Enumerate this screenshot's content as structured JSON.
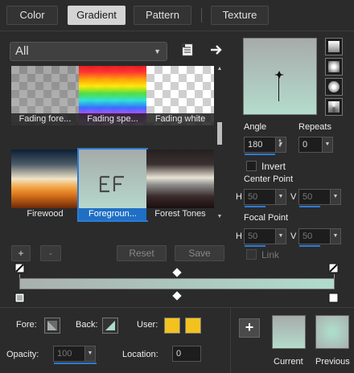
{
  "tabs": [
    {
      "label": "Color",
      "active": false
    },
    {
      "label": "Gradient",
      "active": true
    },
    {
      "label": "Pattern",
      "active": false
    },
    {
      "label": "Texture",
      "active": false
    }
  ],
  "category": {
    "value": "All"
  },
  "gradients": [
    {
      "label": "Fading fore..."
    },
    {
      "label": "Fading spe..."
    },
    {
      "label": "Fading white"
    },
    {
      "label": "Firewood"
    },
    {
      "label": "Foregroun...",
      "selected": true
    },
    {
      "label": "Forest Tones"
    }
  ],
  "editor_buttons": {
    "add": "+",
    "remove": "-",
    "reset": "Reset",
    "save": "Save"
  },
  "angle": {
    "label": "Angle",
    "value": "180"
  },
  "repeats": {
    "label": "Repeats",
    "value": "0"
  },
  "invert": {
    "label": "Invert",
    "checked": false
  },
  "center_point": {
    "label": "Center Point",
    "h_label": "H",
    "h": "50",
    "v_label": "V",
    "v": "50"
  },
  "focal_point": {
    "label": "Focal Point",
    "h_label": "H",
    "h": "50",
    "v_label": "V",
    "v": "50"
  },
  "link": {
    "label": "Link"
  },
  "footer": {
    "fore_label": "Fore:",
    "back_label": "Back:",
    "user_label": "User:",
    "opacity_label": "Opacity:",
    "opacity": "100",
    "location_label": "Location:",
    "location": "0",
    "current_label": "Current",
    "previous_label": "Previous"
  },
  "colors": {
    "accent": "#2d7bd6",
    "gradient_start": "#a9b0ae",
    "gradient_end": "#b0dccd",
    "user_swatch": "#f3c21f"
  }
}
